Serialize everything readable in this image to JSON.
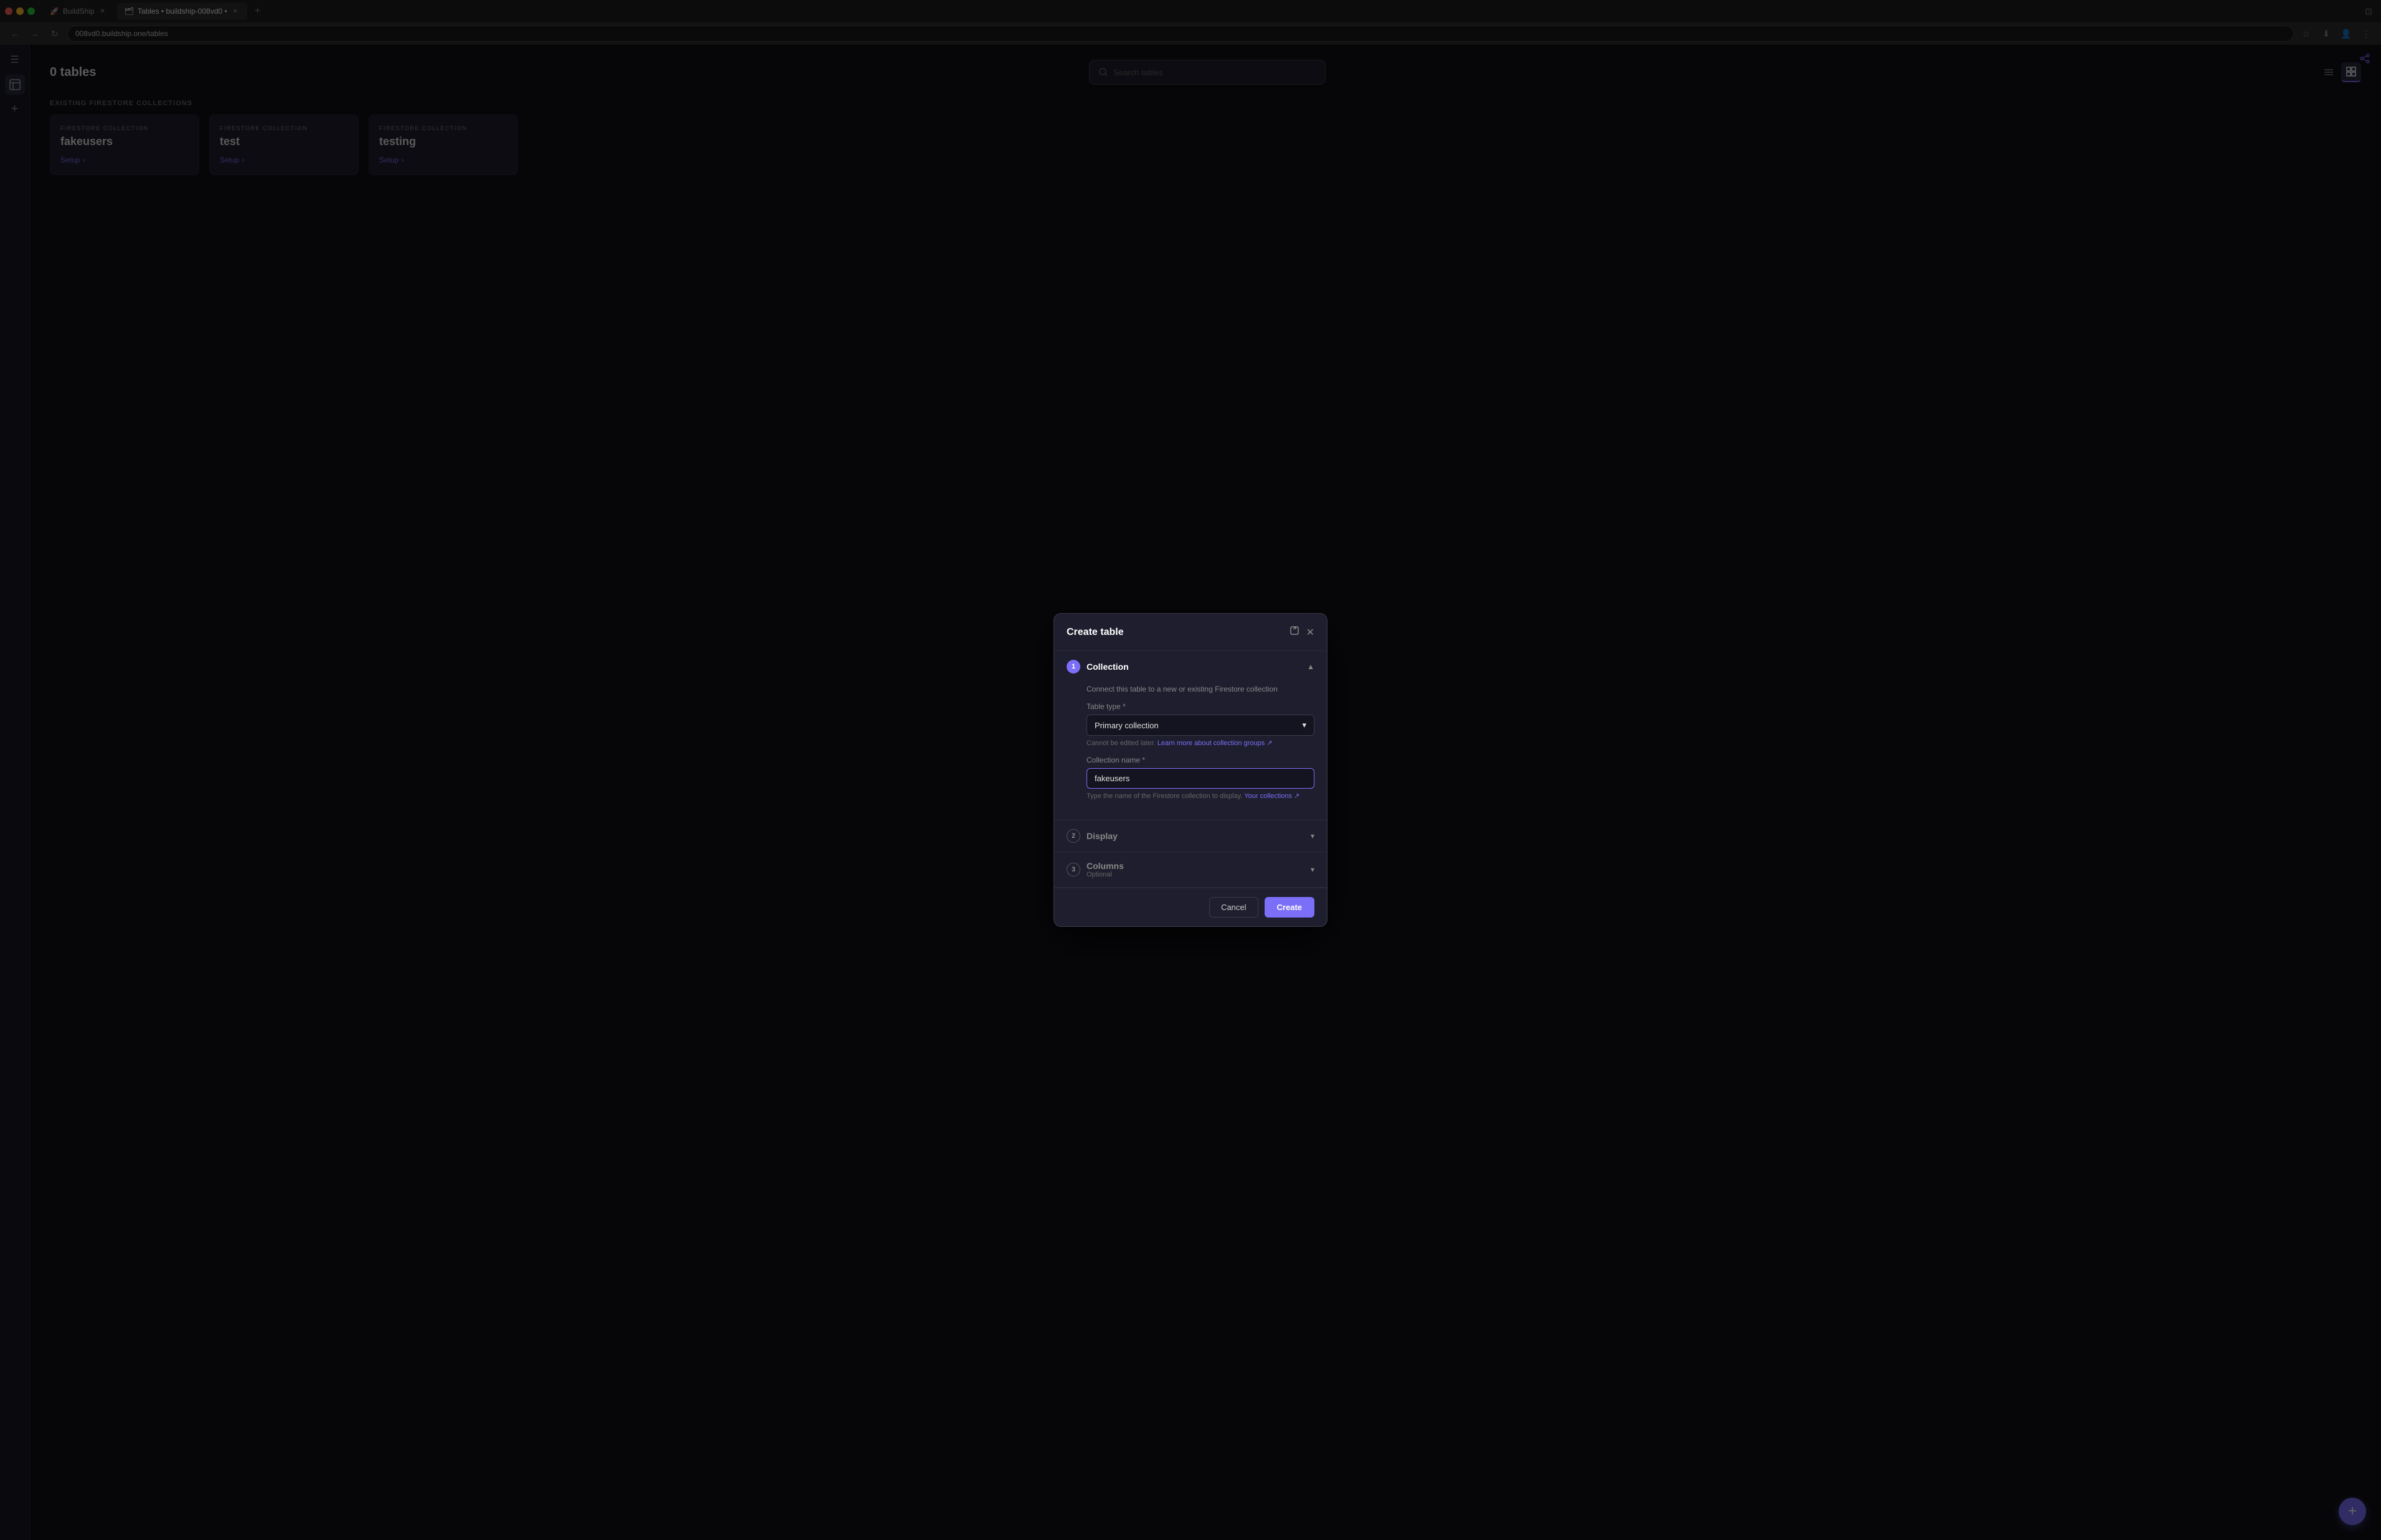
{
  "browser": {
    "url": "008vd0.buildship.one/tables",
    "tabs": [
      {
        "label": "BuildShip",
        "active": false,
        "icon": "🚀"
      },
      {
        "label": "Tables • buildship-008vd0 •",
        "active": true,
        "icon": "🗂"
      }
    ]
  },
  "page": {
    "title": "0 tables",
    "search_placeholder": "Search tables",
    "section_label": "Existing Firestore Collections",
    "collections": [
      {
        "type": "FIRESTORE COLLECTION",
        "name": "fakeusers",
        "setup_label": "Setup"
      },
      {
        "type": "FIRESTORE COLLECTION",
        "name": "test",
        "setup_label": "Setup"
      },
      {
        "type": "FIRESTORE COLLECTION",
        "name": "testing",
        "setup_label": "Setup"
      }
    ]
  },
  "modal": {
    "title": "Create table",
    "sections": [
      {
        "step": "1",
        "label": "Collection",
        "active": true,
        "desc": "Connect this table to a new or existing Firestore collection",
        "fields": [
          {
            "label": "Table type",
            "required": true,
            "type": "select",
            "value": "Primary collection",
            "hint": "Cannot be edited later. Learn more about collection groups ↗"
          },
          {
            "label": "Collection name",
            "required": true,
            "type": "text",
            "value": "fakeusers",
            "hint": "Type the name of the Firestore collection to display. Your collections ↗"
          }
        ]
      },
      {
        "step": "2",
        "label": "Display",
        "active": false
      },
      {
        "step": "3",
        "label": "Columns",
        "active": false,
        "optional_label": "Optional"
      }
    ],
    "cancel_label": "Cancel",
    "create_label": "Create"
  }
}
